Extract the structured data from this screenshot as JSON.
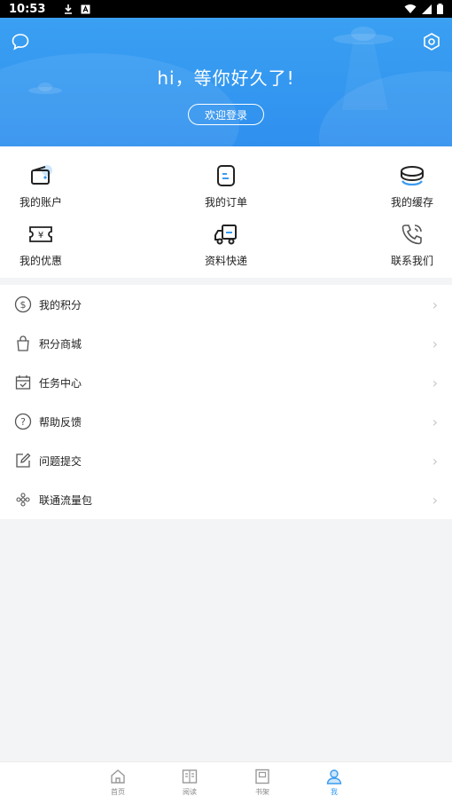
{
  "status": {
    "time": "10:53"
  },
  "header": {
    "greeting": "hi，等你好久了!",
    "login_label": "欢迎登录"
  },
  "grid": {
    "items": [
      {
        "label": "我的账户",
        "icon": "wallet-icon"
      },
      {
        "label": "我的订单",
        "icon": "order-icon"
      },
      {
        "label": "我的缓存",
        "icon": "cache-icon"
      },
      {
        "label": "我的优惠",
        "icon": "coupon-icon"
      },
      {
        "label": "资料快递",
        "icon": "truck-icon"
      },
      {
        "label": "联系我们",
        "icon": "phone-icon"
      }
    ]
  },
  "menu": {
    "items": [
      {
        "label": "我的积分",
        "icon": "points-icon"
      },
      {
        "label": "积分商城",
        "icon": "shopping-bag-icon"
      },
      {
        "label": "任务中心",
        "icon": "calendar-check-icon"
      },
      {
        "label": "帮助反馈",
        "icon": "help-icon"
      },
      {
        "label": "问题提交",
        "icon": "edit-icon"
      },
      {
        "label": "联通流量包",
        "icon": "unicom-icon"
      }
    ]
  },
  "bottom_nav": {
    "tabs": [
      {
        "label": "首页",
        "icon": "home-icon",
        "active": false
      },
      {
        "label": "阅读",
        "icon": "book-icon",
        "active": false
      },
      {
        "label": "书架",
        "icon": "bookshelf-icon",
        "active": false
      },
      {
        "label": "我",
        "icon": "user-icon",
        "active": true
      }
    ]
  },
  "colors": {
    "accent": "#3a9bf0",
    "header_bg": "#3aa0f2"
  }
}
